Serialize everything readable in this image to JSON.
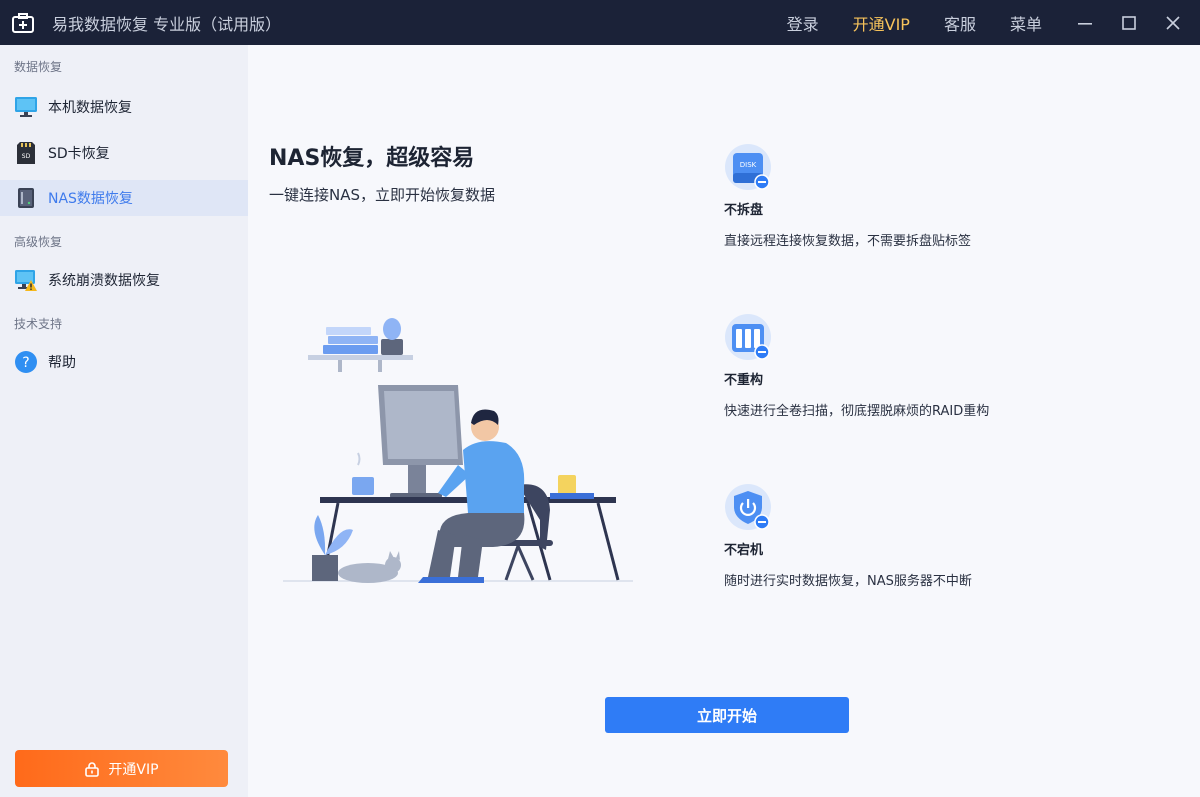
{
  "titlebar": {
    "app_title": "易我数据恢复 专业版（试用版）",
    "login": "登录",
    "vip": "开通VIP",
    "service": "客服",
    "menu": "菜单"
  },
  "sidebar": {
    "sections": [
      {
        "label": "数据恢复",
        "items": [
          {
            "label": "本机数据恢复",
            "icon": "monitor-icon"
          },
          {
            "label": "SD卡恢复",
            "icon": "sd-card-icon"
          },
          {
            "label": "NAS数据恢复",
            "icon": "nas-icon",
            "active": true
          }
        ]
      },
      {
        "label": "高级恢复",
        "items": [
          {
            "label": "系统崩溃数据恢复",
            "icon": "system-crash-icon"
          }
        ]
      },
      {
        "label": "技术支持",
        "items": [
          {
            "label": "帮助",
            "icon": "help-icon"
          }
        ]
      }
    ],
    "vip_button": "开通VIP"
  },
  "main": {
    "headline": "NAS恢复，超级容易",
    "subhead": "一键连接NAS，立即开始恢复数据",
    "features": [
      {
        "title": "不拆盘",
        "desc": "直接远程连接恢复数据，不需要拆盘贴标签",
        "icon": "disk-icon",
        "icon_text": "DISK"
      },
      {
        "title": "不重构",
        "desc": "快速进行全卷扫描，彻底摆脱麻烦的RAID重构",
        "icon": "raid-icon"
      },
      {
        "title": "不宕机",
        "desc": "随时进行实时数据恢复，NAS服务器不中断",
        "icon": "power-shield-icon"
      }
    ],
    "start_button": "立即开始"
  },
  "colors": {
    "titlebar_bg": "#1b2238",
    "accent": "#2f7cf6",
    "vip_orange": "#ff6a1a",
    "vip_text": "#f7c35b"
  }
}
